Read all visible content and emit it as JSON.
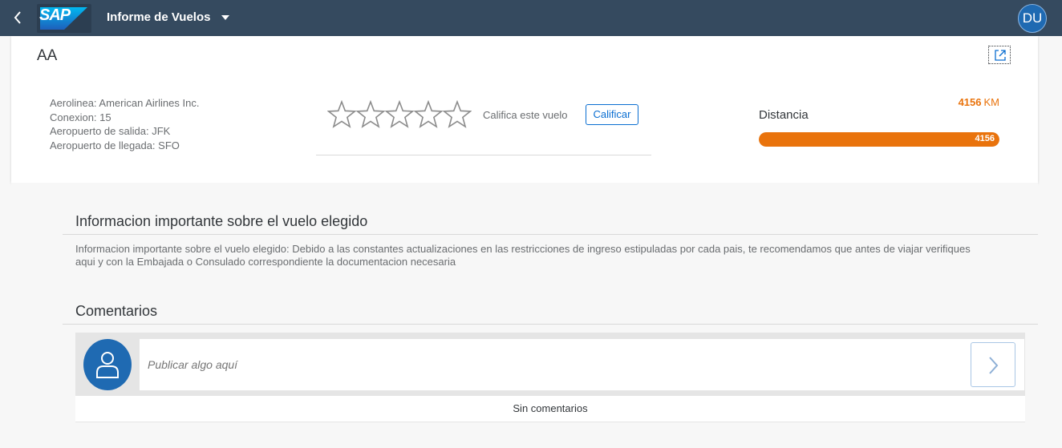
{
  "shell": {
    "logo_text": "SAP",
    "app_title": "Informe de Vuelos",
    "user_initials": "DU"
  },
  "header": {
    "object_title": "AA",
    "attributes": [
      "Aerolinea: American Airlines Inc.",
      "Conexion: 15",
      "Aeropuerto de salida: JFK",
      "Aeropuerto de llegada: SFO"
    ],
    "rating": {
      "stars_total": 5,
      "stars_filled": 0,
      "label": "Califica este vuelo",
      "button_label": "Calificar"
    },
    "distance": {
      "label": "Distancia",
      "value": "4156",
      "unit": "KM",
      "bar_label": "4156",
      "bar_fraction": 1.0
    }
  },
  "info_section": {
    "title": "Informacion importante sobre el vuelo elegido",
    "text": "Informacion importante sobre el vuelo elegido: Debido a las constantes actualizaciones en las restricciones de ingreso estipuladas por cada pais, te recomendamos que antes de viajar verifiques aqui y con la Embajada o Consulado correspondiente la documentacion necesaria"
  },
  "comments_section": {
    "title": "Comentarios",
    "input_placeholder": "Publicar algo aquí",
    "empty_text": "Sin comentarios"
  },
  "colors": {
    "shell_bg": "#354a5f",
    "accent_blue": "#0a6ed1",
    "critical_orange": "#e9730c"
  },
  "icons": {
    "back": "back-icon",
    "dropdown": "chevron-down-icon",
    "share": "share-icon",
    "star": "star-icon",
    "user": "user-icon",
    "post": "chevron-right-icon"
  }
}
